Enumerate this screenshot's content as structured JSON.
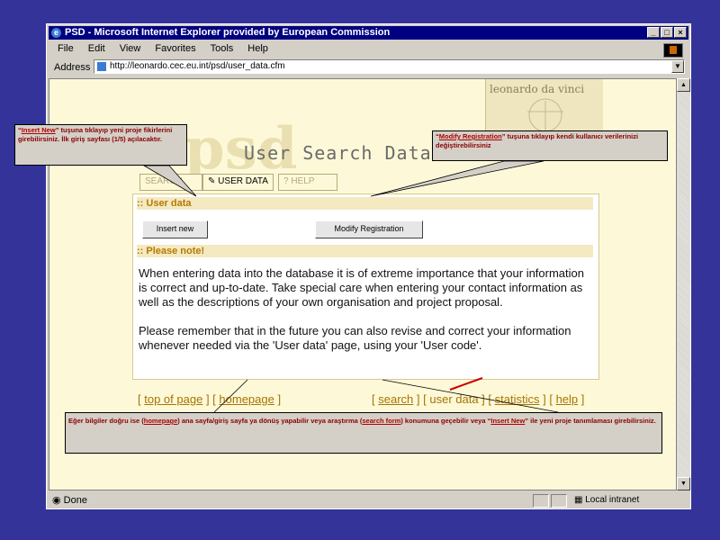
{
  "window": {
    "title": "PSD - Microsoft Internet Explorer provided by European Commission",
    "controls": [
      "_",
      "□",
      "×"
    ]
  },
  "menu": [
    "File",
    "Edit",
    "View",
    "Favorites",
    "Tools",
    "Help"
  ],
  "address": {
    "label": "Address",
    "url": "http://leonardo.cec.eu.int/psd/user_data.cfm"
  },
  "page": {
    "logo_psd": "psd",
    "logo_title": "User Search Database",
    "leonardo": "leonardo da vinci",
    "tabs": [
      {
        "label": "SEARCH"
      },
      {
        "label": "USER DATA"
      },
      {
        "label": "? HELP"
      }
    ],
    "sections": {
      "user_data": ":: User data",
      "please_note": ":: Please note!"
    },
    "buttons": {
      "insert_new": "Insert new",
      "modify": "Modify Registration"
    },
    "note_paragraphs": [
      "When entering data into the database it is of extreme importance that your information is correct and up-to-date. Take special care when entering your contact information as well as the descriptions of your own organisation and project proposal.",
      "Please remember that in the future you can also revise and correct your information whenever needed via the 'User data' page, using your 'User code'."
    ],
    "footer_left": {
      "open1": "[",
      "top": "top of page",
      "mid": "] [",
      "home": "homepage",
      "close": "]"
    },
    "footer_right": {
      "open1": "[",
      "search": "search",
      "mid1": "] [ user data ] [",
      "stats": "statistics",
      "mid2": "] [",
      "help": "help",
      "close": "]"
    }
  },
  "callouts": {
    "c1": {
      "q1": "“",
      "link": "Insert New",
      "rest": "” tuşuna tıklayıp yeni proje fikirlerini girebilirsiniz. İlk giriş sayfası (1/5) açılacaktır."
    },
    "c2": {
      "q1": "“",
      "link": "Modify Registration",
      "rest": "” tuşuna tıklayıp kendi kullanıcı verilerinizi değiştirebilirsiniz"
    },
    "c3": {
      "p1": "Eğer bilgiler doğru ise (",
      "l1": "homepage",
      "p2": ") ana sayfa/giriş sayfa ya dönüş yapabilir veya araştırma (",
      "l2": "search form",
      "p3": ") konumuna geçebilir veya “",
      "l3": "Insert New",
      "p4": "” ile yeni proje tanımlaması girebilirsiniz."
    }
  },
  "status": {
    "text": "Done",
    "zone": "Local intranet"
  }
}
